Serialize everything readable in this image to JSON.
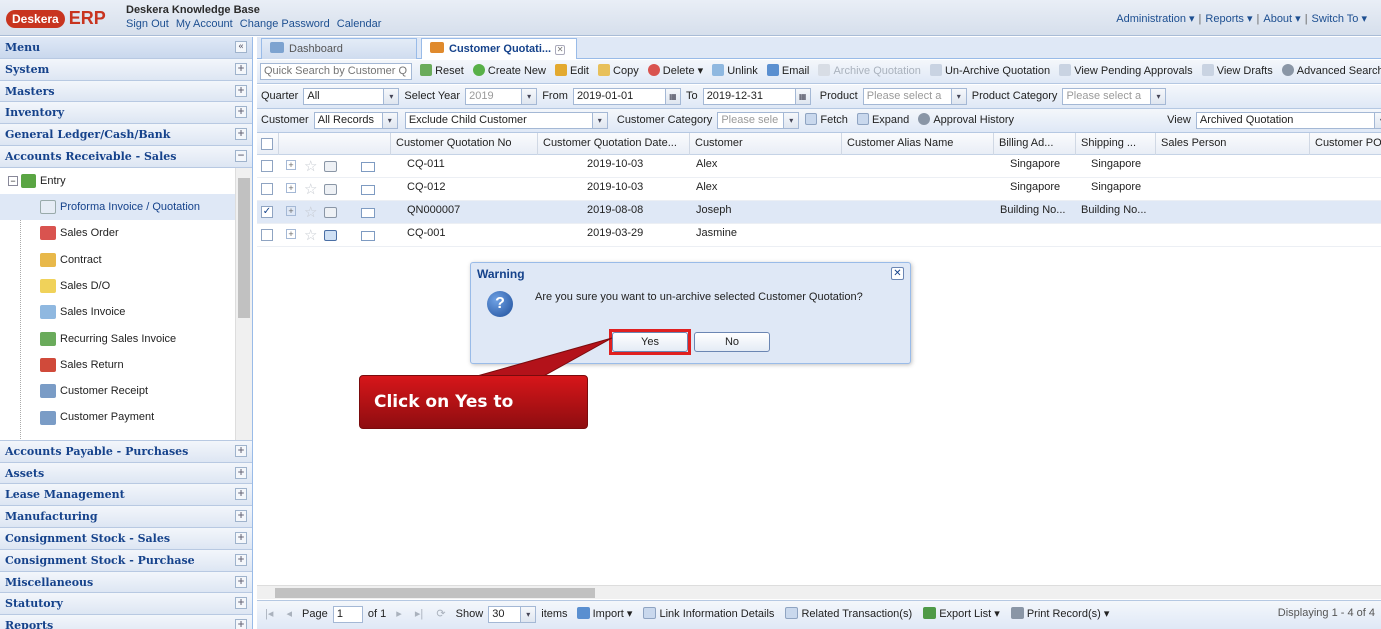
{
  "header": {
    "logo_text": "Deskera",
    "logo_erp": "ERP",
    "kb_title": "Deskera Knowledge Base",
    "links": [
      "Sign Out",
      "My Account",
      "Change Password",
      "Calendar"
    ],
    "nav": [
      "Administration ▾",
      "Reports ▾",
      "About ▾",
      "Switch To ▾"
    ]
  },
  "sidebar": {
    "menu_title": "Menu",
    "collapse_icon": "«",
    "sections_top": [
      "System",
      "Masters",
      "Inventory",
      "General Ledger/Cash/Bank",
      "Accounts Receivable - Sales"
    ],
    "entry_label": "Entry",
    "entry_items": [
      "Proforma Invoice / Quotation",
      "Sales Order",
      "Contract",
      "Sales D/O",
      "Sales Invoice",
      "Recurring Sales Invoice",
      "Sales Return",
      "Customer Receipt",
      "Customer Payment"
    ],
    "sections_bottom": [
      "Accounts Payable - Purchases",
      "Assets",
      "Lease Management",
      "Manufacturing",
      "Consignment Stock - Sales",
      "Consignment Stock - Purchase",
      "Miscellaneous",
      "Statutory",
      "Reports"
    ]
  },
  "tabs": [
    {
      "label": "Dashboard"
    },
    {
      "label": "Customer Quotati..."
    }
  ],
  "toolbar1": {
    "search_placeholder": "Quick Search by Customer Q",
    "buttons": [
      "Reset",
      "Create New",
      "Edit",
      "Copy",
      "Delete ▾",
      "Unlink",
      "Email",
      "Archive Quotation",
      "Un-Archive Quotation",
      "View Pending Approvals",
      "View Drafts",
      "Advanced Search"
    ]
  },
  "toolbar2": {
    "quarter_label": "Quarter",
    "quarter_value": "All",
    "year_label": "Select Year",
    "year_value": "2019",
    "from_label": "From",
    "from_value": "2019-01-01",
    "to_label": "To",
    "to_value": "2019-12-31",
    "product_label": "Product",
    "product_placeholder": "Please select a",
    "product_cat_label": "Product Category",
    "product_cat_placeholder": "Please select a"
  },
  "toolbar3": {
    "customer_label": "Customer",
    "customer_value": "All Records",
    "child_value": "Exclude Child Customer",
    "cust_cat_label": "Customer Category",
    "cust_cat_placeholder": "Please sele",
    "fetch": "Fetch",
    "expand": "Expand",
    "approval": "Approval History",
    "view_label": "View",
    "view_value": "Archived Quotation"
  },
  "grid": {
    "columns": [
      "Customer Quotation No",
      "Customer Quotation Date...",
      "Customer",
      "Customer Alias Name",
      "Billing Ad...",
      "Shipping ...",
      "Sales Person",
      "Customer PO"
    ],
    "rows": [
      {
        "no": "CQ-011",
        "date": "2019-10-03",
        "customer": "Alex",
        "billing": "Singapore",
        "shipping": "Singapore",
        "checked": false
      },
      {
        "no": "CQ-012",
        "date": "2019-10-03",
        "customer": "Alex",
        "billing": "Singapore",
        "shipping": "Singapore",
        "checked": false
      },
      {
        "no": "QN000007",
        "date": "2019-08-08",
        "customer": "Joseph",
        "billing": "Building No...",
        "shipping": "Building No...",
        "checked": true
      },
      {
        "no": "CQ-001",
        "date": "2019-03-29",
        "customer": "Jasmine",
        "billing": "",
        "shipping": "",
        "checked": false
      }
    ]
  },
  "dialog": {
    "title": "Warning",
    "message": "Are you sure you want to un-archive selected Customer Quotation?",
    "yes": "Yes",
    "no": "No"
  },
  "callout": {
    "text": "Click on Yes to confirm"
  },
  "pager": {
    "page_label": "Page",
    "page_value": "1",
    "of_label": "of 1",
    "show_label": "Show",
    "show_value": "30",
    "items_label": "items",
    "import": "Import ▾",
    "link_info": "Link Information Details",
    "related": "Related Transaction(s)",
    "export": "Export List ▾",
    "print": "Print Record(s) ▾",
    "display": "Displaying 1 - 4 of 4"
  },
  "colors": {
    "accent": "#15428b",
    "brand": "#c8341f",
    "callout": "#c8141a",
    "highlight": "#e02020"
  }
}
